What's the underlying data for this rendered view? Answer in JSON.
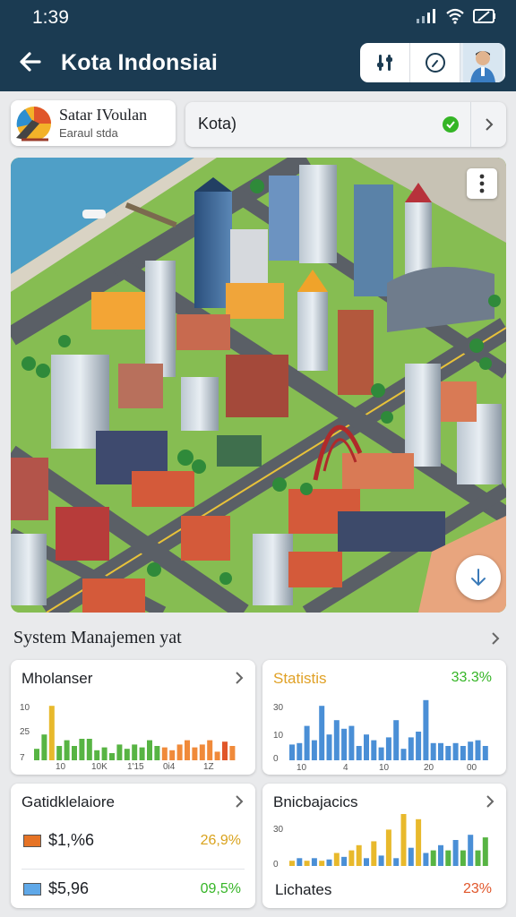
{
  "status": {
    "time": "1:39"
  },
  "header": {
    "title": "Kota Indonsiai"
  },
  "brand": {
    "name": "Satar IVoulan",
    "subtitle": "Earaul stda"
  },
  "location_select": {
    "value": "Kota)"
  },
  "section": {
    "title": "System Manajemen yat"
  },
  "colors": {
    "primary": "#1b3b52",
    "green": "#35b526",
    "orange": "#e67325",
    "blue": "#4a8fd6",
    "yellow": "#e8b92c"
  },
  "panels": {
    "p1": {
      "title": "Mholanser",
      "y_ticks": [
        "10",
        "25",
        "7"
      ],
      "x_ticks": [
        "10",
        "10K",
        "1'15",
        "0i4",
        "1Z"
      ],
      "chart_data": {
        "type": "bar",
        "values": [
          8,
          18,
          38,
          10,
          14,
          10,
          15,
          15,
          7,
          9,
          5,
          11,
          8,
          11,
          9,
          14,
          10,
          9,
          7,
          11,
          14,
          9,
          11,
          14,
          6,
          13,
          10
        ],
        "colors": [
          "green",
          "green",
          "yellow",
          "green",
          "green",
          "green",
          "green",
          "green",
          "green",
          "green",
          "green",
          "green",
          "green",
          "green",
          "green",
          "green",
          "green",
          "orange",
          "orange",
          "orange",
          "orange",
          "orange",
          "orange",
          "orange",
          "orange",
          "red",
          "orange"
        ]
      }
    },
    "p2": {
      "title": "Statistis",
      "value": "33.3%",
      "y_ticks": [
        "30",
        "10",
        "0"
      ],
      "x_ticks": [
        "10",
        "4",
        "10",
        "20",
        "00"
      ],
      "chart_data": {
        "type": "bar",
        "values": [
          11,
          12,
          24,
          14,
          38,
          18,
          28,
          22,
          24,
          10,
          18,
          14,
          9,
          16,
          28,
          8,
          16,
          20,
          42,
          12,
          12,
          10,
          12,
          10,
          13,
          14,
          10
        ],
        "colors": [
          "blue"
        ]
      }
    },
    "p3": {
      "title": "Gatidklelaiore",
      "rows": [
        {
          "amount": "$1,%6",
          "pct": "26,9%",
          "swatch": "#e67325",
          "pct_color": "#d9a21c"
        },
        {
          "amount": "$5,96",
          "pct": "09,5%",
          "swatch": "#5fa8e8",
          "pct_color": "#35b526"
        }
      ]
    },
    "p4": {
      "title": "Bnicbajacics",
      "y_ticks": [
        "30",
        "0"
      ],
      "footer_label": "Lichates",
      "footer_value": "23%",
      "chart_data": {
        "type": "bar",
        "values": [
          4,
          6,
          4,
          6,
          4,
          5,
          10,
          7,
          12,
          16,
          6,
          19,
          8,
          28,
          6,
          40,
          14,
          36,
          10,
          12,
          16,
          12,
          20,
          12,
          24,
          12,
          22
        ],
        "colors": [
          "yellow",
          "blue",
          "yellow",
          "blue",
          "yellow",
          "blue",
          "yellow",
          "blue",
          "yellow",
          "yellow",
          "blue",
          "yellow",
          "blue",
          "yellow",
          "blue",
          "yellow",
          "blue",
          "yellow",
          "blue",
          "green",
          "blue",
          "green",
          "blue",
          "green",
          "blue",
          "green",
          "green"
        ]
      }
    }
  }
}
